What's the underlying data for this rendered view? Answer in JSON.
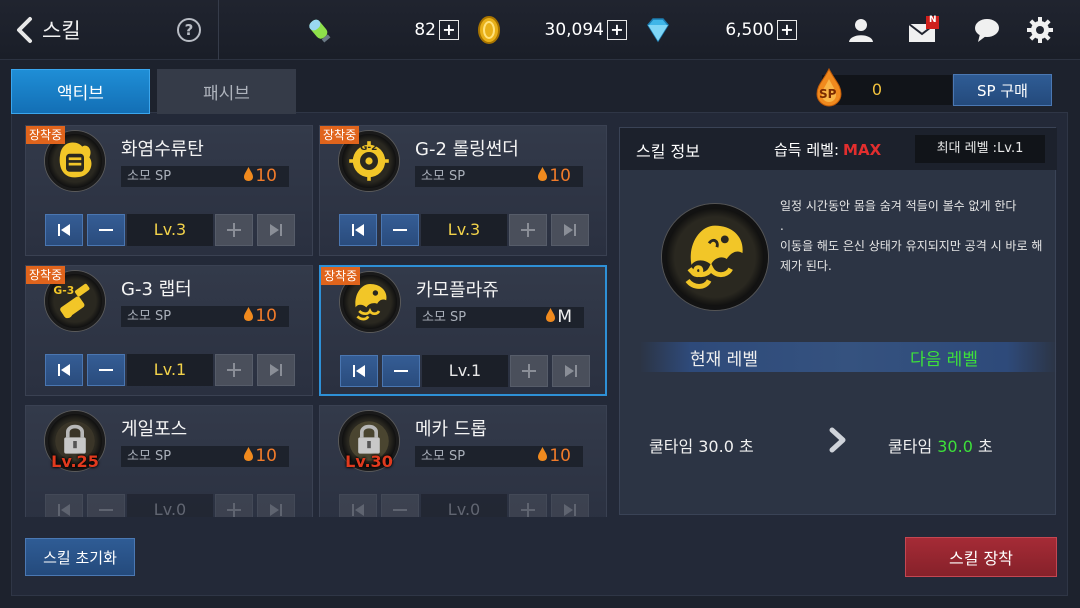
{
  "header": {
    "title": "스킬",
    "help_label": "?",
    "currencies": [
      {
        "icon": "energy-capsule-icon",
        "value": "82"
      },
      {
        "icon": "gold-coin-icon",
        "value": "30,094"
      },
      {
        "icon": "diamond-gem-icon",
        "value": "6,500"
      }
    ],
    "mail_badge": "N"
  },
  "tabs": [
    {
      "label": "액티브",
      "active": true
    },
    {
      "label": "패시브",
      "active": false
    }
  ],
  "sp": {
    "icon_label": "SP",
    "value": "0",
    "buy_label": "SP 구매"
  },
  "skills": [
    {
      "name": "화염수류탄",
      "equipped_label": "장착중",
      "sp_label": "소모 SP",
      "cost": "10",
      "level": "Lv.3",
      "locked": false,
      "lock_level": ""
    },
    {
      "name": "G-2 롤링썬더",
      "equipped_label": "장착중",
      "sp_label": "소모 SP",
      "cost": "10",
      "level": "Lv.3",
      "locked": false,
      "lock_level": ""
    },
    {
      "name": "G-3 랩터",
      "equipped_label": "장착중",
      "sp_label": "소모 SP",
      "cost": "10",
      "level": "Lv.1",
      "locked": false,
      "lock_level": ""
    },
    {
      "name": "카모플라쥬",
      "equipped_label": "장착중",
      "sp_label": "소모 SP",
      "cost": "M",
      "level": "Lv.1",
      "locked": false,
      "lock_level": ""
    },
    {
      "name": "게일포스",
      "equipped_label": "",
      "sp_label": "소모 SP",
      "cost": "10",
      "level": "Lv.0",
      "locked": true,
      "lock_level": "Lv.25"
    },
    {
      "name": "메카 드롭",
      "equipped_label": "",
      "sp_label": "소모 SP",
      "cost": "10",
      "level": "Lv.0",
      "locked": true,
      "lock_level": "Lv.30"
    }
  ],
  "info": {
    "title": "스킬 정보",
    "acquired_label": "습득 레벨:",
    "acquired_value": "MAX",
    "max_level": "최대 레벨 :Lv.1",
    "description_1": "일정 시간동안 몸을 숨겨 적들이 볼수 없게 한다",
    "description_2": ".",
    "description_3": "이동을 해도 은신 상태가 유지되지만 공격 시 바로 해제가 된다.",
    "current_level_label": "현재 레벨",
    "next_level_label": "다음 레벨",
    "cooldown_current": "쿨타임 30.0 초",
    "cooldown_next_prefix": "쿨타임 ",
    "cooldown_next_value": "30.0",
    "cooldown_next_suffix": " 초"
  },
  "buttons": {
    "reset": "스킬 초기화",
    "equip": "스킬 장착"
  },
  "colors": {
    "tab_active": "#1f8ed6",
    "equipped_badge": "#e0641c",
    "level_yellow": "#f2d24a",
    "next_green": "#3de03a",
    "max_red": "#e22e2e",
    "equip_button": "#a52b36",
    "blue_button": "#2f5c95"
  }
}
